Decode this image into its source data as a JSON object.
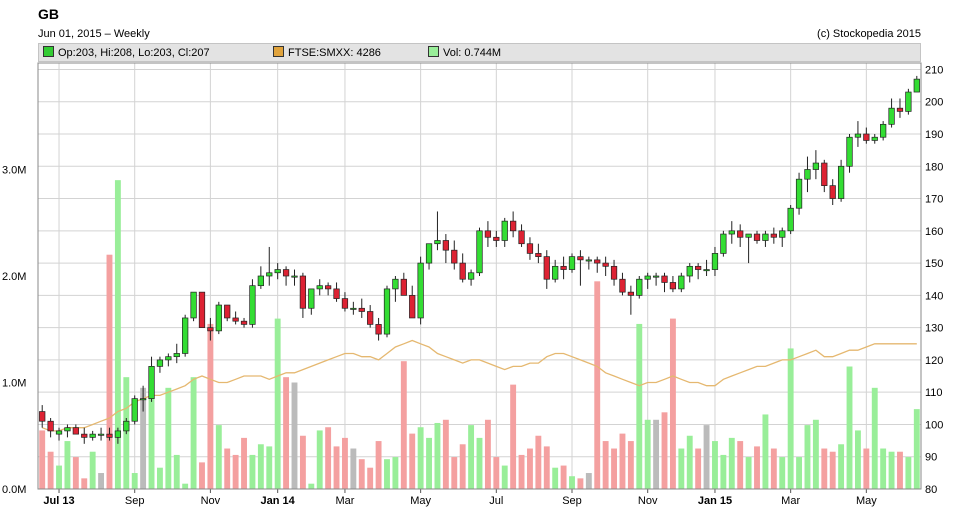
{
  "header": {
    "ticker": "GB",
    "date_line": "Jun 01, 2015  – Weekly",
    "copyright": "(c) Stockopedia 2015"
  },
  "legend": [
    {
      "label": "Op:203, Hi:208, Lo:203, Cl:207",
      "color": "#33cc33"
    },
    {
      "label": "FTSE:SMXX: 4286",
      "color": "#e0a33c"
    },
    {
      "label": "Vol: 0.744M",
      "color": "#99ee99"
    }
  ],
  "colors": {
    "up": "#33dd33",
    "down": "#dd2233",
    "vol_up": "#99ee99",
    "vol_down": "#f4a0a0",
    "vol_flat": "#bbbbbb",
    "index_line": "#e5b870",
    "grid": "#d3d3d3",
    "wick": "#222222"
  },
  "chart_data": {
    "type": "candlestick",
    "interval": "Weekly",
    "price_axis": {
      "side": "right",
      "ylim": [
        80,
        212
      ],
      "ticks": [
        "80",
        "90",
        "100",
        "110",
        "120",
        "130",
        "140",
        "150",
        "160",
        "170",
        "180",
        "190",
        "200",
        "210"
      ]
    },
    "volume_axis": {
      "side": "left",
      "ylim": [
        0,
        4.0
      ],
      "ticks": [
        "0.0M",
        "1.0M",
        "2.0M",
        "3.0M"
      ]
    },
    "x_labels": [
      "Jul 13",
      "Sep",
      "Nov",
      "Jan 14",
      "Mar",
      "May",
      "Jul",
      "Sep",
      "Nov",
      "Jan 15",
      "Mar",
      "May"
    ],
    "x_bold_labels": [
      "Jul 13",
      "Jan 14",
      "Jan 15"
    ],
    "x_label_week_index": [
      2,
      11,
      20,
      28,
      36,
      45,
      54,
      63,
      72,
      80,
      89,
      98
    ],
    "grid": true,
    "ohlc": [
      [
        104,
        106,
        99,
        101
      ],
      [
        101,
        102,
        96,
        98
      ],
      [
        97,
        99,
        95,
        98
      ],
      [
        98,
        100,
        96,
        99
      ],
      [
        99,
        100,
        97,
        97
      ],
      [
        97,
        99,
        94,
        96
      ],
      [
        96,
        98,
        95,
        97
      ],
      [
        97,
        99,
        95,
        97
      ],
      [
        97,
        99,
        95,
        96
      ],
      [
        96,
        99,
        94,
        98
      ],
      [
        98,
        102,
        97,
        101
      ],
      [
        101,
        109,
        100,
        108
      ],
      [
        108,
        112,
        104,
        108
      ],
      [
        108,
        121,
        107,
        118
      ],
      [
        118,
        121,
        116,
        120
      ],
      [
        120,
        122,
        118,
        121
      ],
      [
        121,
        125,
        119,
        122
      ],
      [
        122,
        134,
        121,
        133
      ],
      [
        133,
        141,
        132,
        141
      ],
      [
        141,
        141,
        130,
        130
      ],
      [
        130,
        133,
        126,
        129
      ],
      [
        129,
        138,
        128,
        137
      ],
      [
        137,
        137,
        132,
        133
      ],
      [
        133,
        135,
        131,
        132
      ],
      [
        132,
        133,
        130,
        131
      ],
      [
        131,
        145,
        130,
        143
      ],
      [
        143,
        149,
        142,
        146
      ],
      [
        146,
        155,
        143,
        147
      ],
      [
        147,
        150,
        145,
        148
      ],
      [
        148,
        149,
        143,
        146
      ],
      [
        146,
        148,
        143,
        146
      ],
      [
        146,
        147,
        133,
        136
      ],
      [
        136,
        142,
        134,
        142
      ],
      [
        142,
        145,
        140,
        143
      ],
      [
        143,
        144,
        140,
        142
      ],
      [
        142,
        144,
        138,
        139
      ],
      [
        139,
        141,
        135,
        136
      ],
      [
        136,
        138,
        134,
        136
      ],
      [
        136,
        139,
        133,
        135
      ],
      [
        135,
        137,
        130,
        131
      ],
      [
        131,
        133,
        126,
        128
      ],
      [
        128,
        143,
        127,
        142
      ],
      [
        142,
        146,
        138,
        145
      ],
      [
        145,
        147,
        140,
        140
      ],
      [
        140,
        143,
        133,
        133
      ],
      [
        133,
        152,
        131,
        150
      ],
      [
        150,
        156,
        148,
        156
      ],
      [
        156,
        166,
        154,
        157
      ],
      [
        157,
        159,
        150,
        154
      ],
      [
        154,
        157,
        148,
        150
      ],
      [
        150,
        153,
        144,
        145
      ],
      [
        145,
        148,
        143,
        147
      ],
      [
        147,
        161,
        146,
        160
      ],
      [
        160,
        163,
        155,
        158
      ],
      [
        158,
        160,
        155,
        157
      ],
      [
        157,
        164,
        155,
        163
      ],
      [
        163,
        166,
        158,
        160
      ],
      [
        160,
        162,
        155,
        156
      ],
      [
        156,
        158,
        151,
        153
      ],
      [
        153,
        156,
        150,
        152
      ],
      [
        152,
        154,
        142,
        145
      ],
      [
        145,
        151,
        144,
        149
      ],
      [
        149,
        152,
        145,
        148
      ],
      [
        148,
        153,
        147,
        152
      ],
      [
        152,
        154,
        143,
        151
      ],
      [
        151,
        152,
        148,
        151
      ],
      [
        151,
        152,
        147,
        150
      ],
      [
        150,
        152,
        146,
        149
      ],
      [
        149,
        151,
        143,
        145
      ],
      [
        145,
        147,
        140,
        141
      ],
      [
        141,
        143,
        134,
        140
      ],
      [
        140,
        146,
        139,
        145
      ],
      [
        145,
        147,
        142,
        146
      ],
      [
        146,
        147,
        143,
        146
      ],
      [
        146,
        147,
        141,
        144
      ],
      [
        144,
        146,
        141,
        142
      ],
      [
        142,
        147,
        141,
        146
      ],
      [
        146,
        150,
        144,
        149
      ],
      [
        149,
        150,
        145,
        148
      ],
      [
        148,
        151,
        146,
        148
      ],
      [
        148,
        155,
        146,
        153
      ],
      [
        153,
        160,
        152,
        159
      ],
      [
        159,
        163,
        156,
        160
      ],
      [
        160,
        162,
        155,
        158
      ],
      [
        158,
        159,
        150,
        159
      ],
      [
        159,
        160,
        156,
        157
      ],
      [
        157,
        160,
        155,
        159
      ],
      [
        159,
        161,
        156,
        158
      ],
      [
        158,
        161,
        155,
        160
      ],
      [
        160,
        168,
        159,
        167
      ],
      [
        167,
        178,
        165,
        176
      ],
      [
        176,
        183,
        172,
        179
      ],
      [
        179,
        185,
        176,
        181
      ],
      [
        181,
        182,
        172,
        174
      ],
      [
        174,
        176,
        168,
        170
      ],
      [
        170,
        182,
        169,
        180
      ],
      [
        180,
        190,
        178,
        189
      ],
      [
        189,
        194,
        186,
        190
      ],
      [
        190,
        192,
        187,
        188
      ],
      [
        188,
        190,
        187,
        189
      ],
      [
        189,
        194,
        188,
        193
      ],
      [
        193,
        201,
        192,
        198
      ],
      [
        198,
        201,
        195,
        197
      ],
      [
        197,
        204,
        196,
        203
      ],
      [
        203,
        208,
        203,
        207
      ]
    ],
    "volume": [
      0.55,
      0.35,
      0.22,
      0.45,
      0.3,
      0.1,
      0.35,
      0.15,
      2.2,
      2.9,
      1.05,
      0.15,
      0.95,
      0.85,
      0.2,
      0.95,
      0.32,
      0.05,
      1.05,
      0.25,
      1.55,
      0.6,
      0.38,
      0.32,
      0.48,
      0.32,
      0.42,
      0.4,
      1.6,
      1.05,
      1.0,
      0.5,
      0.05,
      0.55,
      0.58,
      0.4,
      0.48,
      0.38,
      0.28,
      0.2,
      0.45,
      0.28,
      0.3,
      1.2,
      0.52,
      0.58,
      0.48,
      0.62,
      0.65,
      0.3,
      0.42,
      0.6,
      0.48,
      0.65,
      0.3,
      0.22,
      0.98,
      0.32,
      0.38,
      0.5,
      0.4,
      0.2,
      0.22,
      0.12,
      0.1,
      0.15,
      1.95,
      0.45,
      0.38,
      0.52,
      0.45,
      1.55,
      0.65,
      0.65,
      0.72,
      1.6,
      0.38,
      0.5,
      0.38,
      0.6,
      0.45,
      0.32,
      0.48,
      0.45,
      0.3,
      0.4,
      0.7,
      0.38,
      0.3,
      1.32,
      0.3,
      0.6,
      0.65,
      0.38,
      0.35,
      0.42,
      1.15,
      0.55,
      0.38,
      0.95,
      0.38,
      0.35,
      0.35,
      0.3,
      0.75
    ],
    "index_line": [
      99,
      98,
      98,
      99,
      99,
      99,
      100,
      101,
      102,
      104,
      105,
      107,
      108,
      109,
      109,
      110,
      111,
      112,
      114,
      115,
      114,
      113,
      113,
      114,
      115,
      115,
      115,
      114,
      115,
      116,
      116,
      117,
      118,
      119,
      120,
      121,
      122,
      122,
      121,
      121,
      120,
      122,
      124,
      125,
      126,
      125,
      124,
      122,
      121,
      120,
      119,
      120,
      120,
      119,
      118,
      117,
      118,
      118,
      119,
      119,
      121,
      122,
      122,
      121,
      120,
      119,
      118,
      116,
      115,
      114,
      113,
      112,
      113,
      113,
      114,
      115,
      114,
      113,
      113,
      112,
      112,
      114,
      115,
      116,
      117,
      118,
      118,
      119,
      120,
      120,
      121,
      122,
      123,
      121,
      121,
      122,
      123,
      123,
      124,
      125,
      125,
      125,
      125,
      125,
      125
    ],
    "index_symbol": "FTSE:SMXX",
    "index_last": 4286
  }
}
